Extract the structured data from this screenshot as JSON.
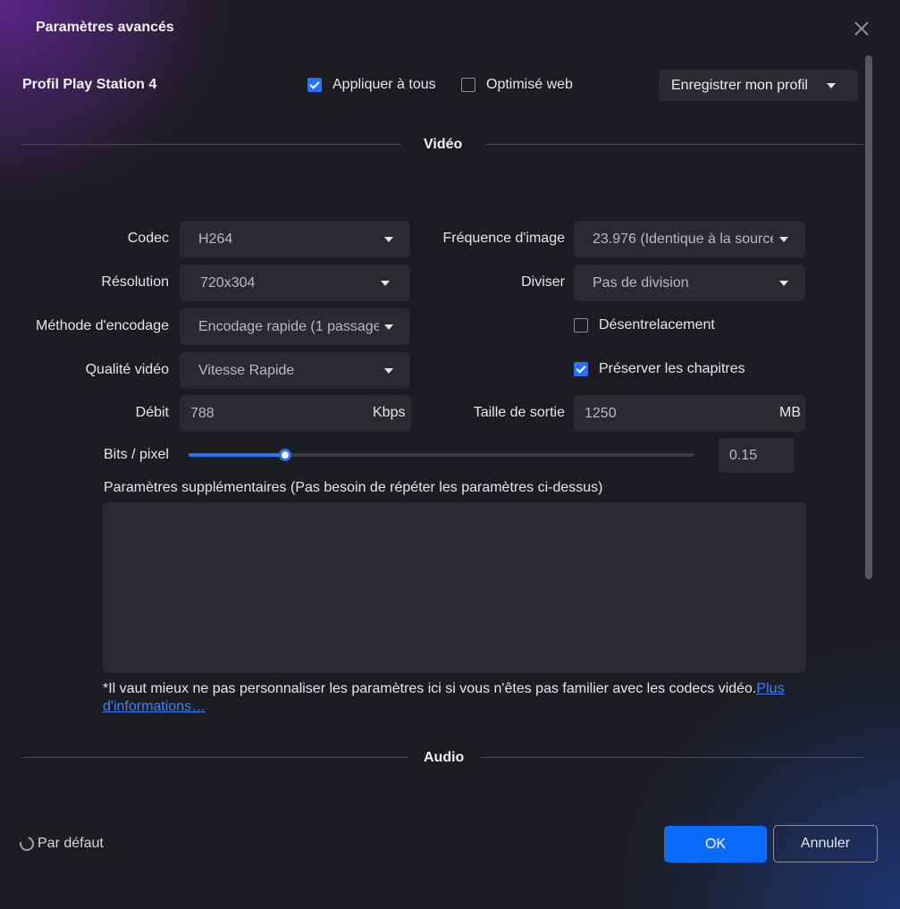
{
  "dialog": {
    "title": "Paramètres avancés"
  },
  "header": {
    "profile_name": "Profil Play Station 4",
    "apply_all": {
      "label": "Appliquer à tous",
      "checked": true
    },
    "web_optimized": {
      "label": "Optimisé web",
      "checked": false
    },
    "save_profile_label": "Enregistrer mon profil"
  },
  "video": {
    "section_title": "Vidéo",
    "codec": {
      "label": "Codec",
      "value": "H264"
    },
    "frame_rate": {
      "label": "Fréquence d'image",
      "value": "23.976 (Identique à la source)"
    },
    "resolution": {
      "label": "Résolution",
      "value": "720x304"
    },
    "split": {
      "label": "Diviser",
      "value": "Pas de division"
    },
    "encoding_method": {
      "label": "Méthode d'encodage",
      "value": "Encodage rapide (1 passage)"
    },
    "deinterlace": {
      "label": "Désentrelacement",
      "checked": false
    },
    "quality": {
      "label": "Qualité vidéo",
      "value": "Vitesse Rapide"
    },
    "chapters": {
      "label": "Préserver les chapitres",
      "checked": true
    },
    "bitrate": {
      "label": "Débit",
      "value": "788",
      "unit": "Kbps"
    },
    "output_size": {
      "label": "Taille de sortie",
      "value": "1250",
      "unit": "MB"
    },
    "bits_per_pixel": {
      "label": "Bits / pixel",
      "value": "0.15",
      "fraction": 0.19
    },
    "extra_params_label": "Paramètres supplémentaires (Pas besoin de répéter les paramètres ci-dessus)",
    "extra_params_value": "",
    "note_text": "*Il vaut mieux ne pas personnaliser les paramètres ici si vous n'êtes pas familier avec les codecs vidéo.",
    "note_link": "Plus d'informations…"
  },
  "audio": {
    "section_title": "Audio"
  },
  "footer": {
    "reset_label": "Par défaut",
    "ok_label": "OK",
    "cancel_label": "Annuler"
  },
  "colors": {
    "accent": "#2472ff",
    "ok_button": "#0a6cff",
    "background": "#1c1d21",
    "control": "#2a2b30"
  },
  "icons": [
    "close-icon",
    "chevron-down-icon",
    "checkbox-icon",
    "reset-icon"
  ]
}
